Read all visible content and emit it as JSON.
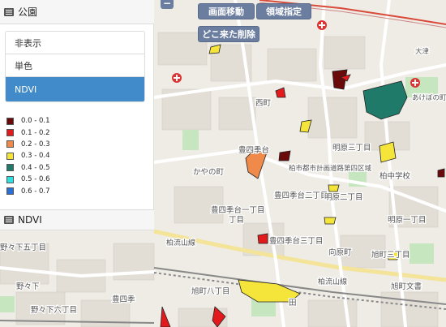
{
  "panel": {
    "header_title": "公園",
    "options": [
      {
        "label": "非表示",
        "active": false
      },
      {
        "label": "単色",
        "active": false
      },
      {
        "label": "NDVI",
        "active": true
      }
    ],
    "legend": [
      {
        "label": "0.0 - 0.1",
        "color": "#6b0a0a"
      },
      {
        "label": "0.1 - 0.2",
        "color": "#e31a1c"
      },
      {
        "label": "0.2 - 0.3",
        "color": "#f08a4b"
      },
      {
        "label": "0.3 - 0.4",
        "color": "#f5e53a"
      },
      {
        "label": "0.4 - 0.5",
        "color": "#1f7a6a"
      },
      {
        "label": "0.5 - 0.6",
        "color": "#2ee0e0"
      },
      {
        "label": "0.6 - 0.7",
        "color": "#2a6fd6"
      }
    ],
    "footer_title": "NDVI"
  },
  "toolbar": {
    "collapse_label": "−",
    "screen_move": "画面移動",
    "area_select": "領域指定",
    "delete_label": "どこ来た削除"
  },
  "map_labels": {
    "nishihara": "西町",
    "asahigaoka": "あけぼの町",
    "toshima_4": "豊四季台",
    "kayanoki": "かやの町",
    "kashiwa_school": "柏市都市計画道路第四区域",
    "meiwa": "明原三丁目",
    "chugakko": "柏中学校",
    "toshima_2": "豊四季台二丁目",
    "meiwa_2": "明原二丁目",
    "toshima_1": "豊四季台一丁目",
    "toshima_3": "豊四季台三丁目",
    "meiwa_1": "明原一丁目",
    "higashi": "向原町",
    "asahi_3": "旭町三丁目",
    "kitakashiwa": "旭町八丁目",
    "asahi_bunkyo": "旭町文書",
    "yaguchi_5": "野々下五丁目",
    "yaguchi_6": "野々下六丁目",
    "toshiki": "豊四季",
    "kashiwa_line": "柏流山線",
    "kashiwa_line2": "柏流山線",
    "yaguchi_st": "野々下",
    "kashiwa_jo": "大津",
    "ju": "丁目",
    "den": "田"
  }
}
